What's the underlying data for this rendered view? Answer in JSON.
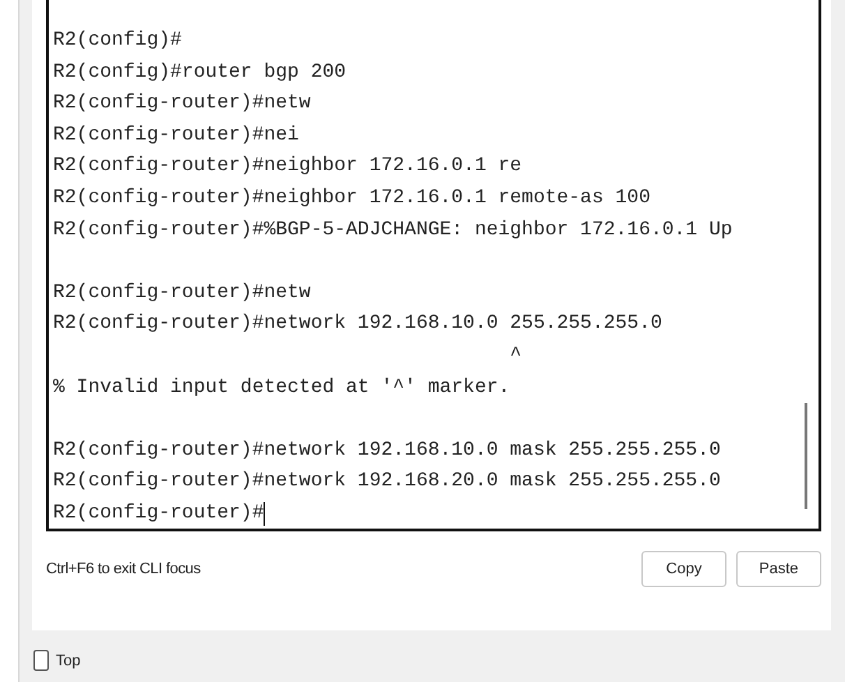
{
  "terminal": {
    "lines": [
      {
        "kind": "text",
        "text": "R2(config)#"
      },
      {
        "kind": "text",
        "text": "R2(config)#router bgp 200"
      },
      {
        "kind": "text",
        "text": "R2(config-router)#netw"
      },
      {
        "kind": "text",
        "text": "R2(config-router)#nei"
      },
      {
        "kind": "text",
        "text": "R2(config-router)#neighbor 172.16.0.1 re"
      },
      {
        "kind": "text",
        "text": "R2(config-router)#neighbor 172.16.0.1 remote-as 100"
      },
      {
        "kind": "text",
        "text": "R2(config-router)#%BGP-5-ADJCHANGE: neighbor 172.16.0.1 Up"
      },
      {
        "kind": "blank"
      },
      {
        "kind": "text",
        "text": "R2(config-router)#netw"
      },
      {
        "kind": "text",
        "text": "R2(config-router)#network 192.168.10.0 255.255.255.0"
      },
      {
        "kind": "text",
        "text": "                                       ^"
      },
      {
        "kind": "text",
        "text": "% Invalid input detected at '^' marker."
      },
      {
        "kind": "blank"
      },
      {
        "kind": "text",
        "text": "R2(config-router)#network 192.168.10.0 mask 255.255.255.0"
      },
      {
        "kind": "text",
        "text": "R2(config-router)#network 192.168.20.0 mask 255.255.255.0"
      },
      {
        "kind": "text",
        "text": "R2(config-router)#"
      }
    ]
  },
  "hint": "Ctrl+F6 to exit CLI focus",
  "buttons": [
    "Copy",
    "Paste"
  ],
  "top_checkbox": {
    "label": "Top",
    "checked": false
  }
}
